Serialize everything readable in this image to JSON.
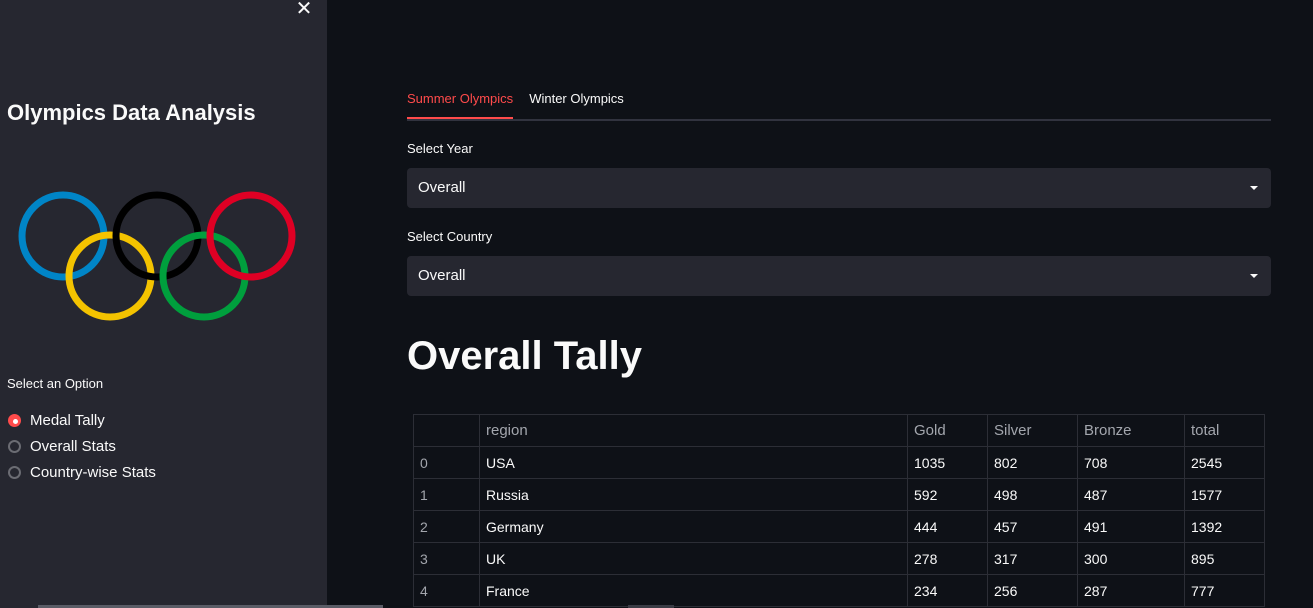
{
  "sidebar": {
    "title": "Olympics Data Analysis",
    "radio_label": "Select an Option",
    "options": [
      "Medal Tally",
      "Overall Stats",
      "Country-wise Stats"
    ],
    "selected_index": 0,
    "close_icon": "close-icon",
    "logo_icon": "olympic-rings",
    "ring_colors": [
      "#0085c7",
      "#f4c300",
      "#000000",
      "#009f3d",
      "#df0024"
    ]
  },
  "tabs": [
    {
      "label": "Summer Olympics",
      "active": true
    },
    {
      "label": "Winter Olympics",
      "active": false
    }
  ],
  "year_select": {
    "label": "Select Year",
    "value": "Overall"
  },
  "country_select": {
    "label": "Select Country",
    "value": "Overall"
  },
  "page_title": "Overall Tally",
  "table": {
    "columns": [
      "",
      "region",
      "Gold",
      "Silver",
      "Bronze",
      "total"
    ],
    "rows": [
      [
        "0",
        "USA",
        "1035",
        "802",
        "708",
        "2545"
      ],
      [
        "1",
        "Russia",
        "592",
        "498",
        "487",
        "1577"
      ],
      [
        "2",
        "Germany",
        "444",
        "457",
        "491",
        "1392"
      ],
      [
        "3",
        "UK",
        "278",
        "317",
        "300",
        "895"
      ],
      [
        "4",
        "France",
        "234",
        "256",
        "287",
        "777"
      ]
    ]
  },
  "colors": {
    "accent": "#ff4b4b",
    "background": "#0e1117",
    "sidebar": "#262730"
  }
}
